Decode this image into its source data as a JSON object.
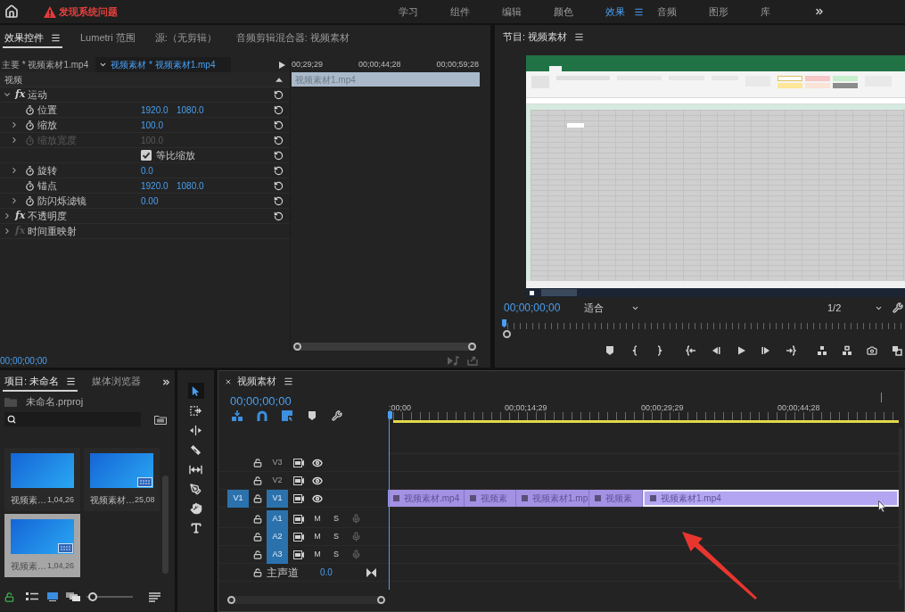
{
  "top_bar": {
    "warning": "发现系统问题",
    "workspaces": [
      {
        "label": "学习",
        "selected": false
      },
      {
        "label": "组件",
        "selected": false
      },
      {
        "label": "编辑",
        "selected": false
      },
      {
        "label": "颜色",
        "selected": false
      },
      {
        "label": "效果",
        "selected": true
      },
      {
        "label": "音频",
        "selected": false
      },
      {
        "label": "图形",
        "selected": false
      },
      {
        "label": "库",
        "selected": false
      }
    ]
  },
  "effect_controls": {
    "tabs": [
      {
        "label": "效果控件",
        "selected": true
      },
      {
        "label": "Lumetri 范围",
        "selected": false
      },
      {
        "label": "源:（无剪辑）",
        "selected": false
      },
      {
        "label": "音频剪辑混合器: 视频素材",
        "selected": false
      }
    ],
    "master_clip": "主要 * 视频素材1.mp4",
    "sequence_clip": "视频素材 * 视频素材1.mp4",
    "ruler": [
      "00;29;29",
      "00;00;44;28",
      "00;00;59;28"
    ],
    "clip": "视频素材1.mp4",
    "section": "视频",
    "effects": [
      {
        "badge": "fx",
        "name": "运动",
        "expanded": true,
        "disabled": false,
        "children": [
          {
            "kind": "param",
            "name": "位置",
            "expandable": false,
            "disabled": false,
            "values": [
              "1920.0",
              "1080.0"
            ]
          },
          {
            "kind": "param",
            "name": "缩放",
            "expandable": true,
            "disabled": false,
            "values": [
              "100.0"
            ]
          },
          {
            "kind": "param",
            "name": "缩放宽度",
            "expandable": true,
            "disabled": true,
            "values": [
              "100.0"
            ]
          },
          {
            "kind": "checkbox",
            "name": "等比缩放",
            "checked": true
          },
          {
            "kind": "param",
            "name": "旋转",
            "expandable": true,
            "disabled": false,
            "values": [
              "0.0"
            ]
          },
          {
            "kind": "param",
            "name": "锚点",
            "expandable": false,
            "disabled": false,
            "values": [
              "1920.0",
              "1080.0"
            ]
          },
          {
            "kind": "param",
            "name": "防闪烁滤镜",
            "expandable": true,
            "disabled": false,
            "values": [
              "0.00"
            ]
          }
        ]
      },
      {
        "badge": "fx",
        "name": "不透明度",
        "expanded": false,
        "disabled": false
      },
      {
        "badge": "fx",
        "name": "时间重映射",
        "expanded": false,
        "disabled": true
      }
    ],
    "timecode": "00;00;00;00"
  },
  "program_monitor": {
    "title": "节目: 视频素材",
    "timecode": "00;00;00;00",
    "fit": "适合",
    "resolution": "1/2"
  },
  "project": {
    "tabs": [
      {
        "label": "项目: 未命名",
        "selected": true
      },
      {
        "label": "媒体浏览器",
        "selected": false
      }
    ],
    "file": "未命名.prproj",
    "items": [
      {
        "name": "视频素…",
        "duration": "1,04,26",
        "sequence": false,
        "selected": false
      },
      {
        "name": "视频素材…",
        "duration": "25,08",
        "sequence": true,
        "selected": false
      },
      {
        "name": "视频素…",
        "duration": "1,04,26",
        "sequence": true,
        "selected": true
      }
    ],
    "zoom": {
      "level": 0.05
    }
  },
  "tools": [
    {
      "kind": "selection",
      "selected": true
    },
    {
      "kind": "track_select",
      "selected": false
    },
    {
      "kind": "ripple",
      "selected": false
    },
    {
      "kind": "razor",
      "selected": false
    },
    {
      "kind": "slip",
      "selected": false
    },
    {
      "kind": "pen",
      "selected": false
    },
    {
      "kind": "hand",
      "selected": false
    },
    {
      "kind": "type",
      "selected": false
    }
  ],
  "timeline": {
    "title": "视频素材",
    "timecode": "00;00;00;00",
    "toggles": [
      {
        "kind": "nest",
        "on": true
      },
      {
        "kind": "snap",
        "on": true
      },
      {
        "kind": "linked",
        "on": true
      }
    ],
    "ruler": [
      ";00;00",
      "00;00;14;29",
      "00;00;29;29",
      "00;00;44;28"
    ],
    "tracks": [
      {
        "kind": "video",
        "name": "V3",
        "targeted": false
      },
      {
        "kind": "video",
        "name": "V2",
        "targeted": false
      },
      {
        "kind": "video",
        "name": "V1",
        "targeted": true,
        "source": "V1",
        "clips": [
          {
            "name": "视频素材.mp4",
            "selected": false
          },
          {
            "name": "视频素",
            "selected": false
          },
          {
            "name": "视频素材1.mp",
            "selected": false
          },
          {
            "name": "视频素",
            "selected": false
          },
          {
            "name": "视频素材1.mp4",
            "selected": true
          }
        ]
      },
      {
        "kind": "audio",
        "name": "A1",
        "targeted": true,
        "mute": "M",
        "solo": "S"
      },
      {
        "kind": "audio",
        "name": "A2",
        "targeted": true,
        "mute": "M",
        "solo": "S"
      },
      {
        "kind": "audio",
        "name": "A3",
        "targeted": true,
        "mute": "M",
        "solo": "S"
      },
      {
        "kind": "master",
        "name": "主声道",
        "volume": "0.0"
      }
    ]
  }
}
